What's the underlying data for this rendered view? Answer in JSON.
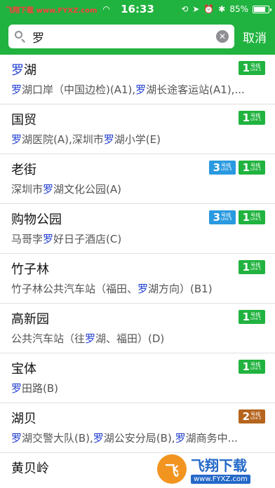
{
  "status_bar": {
    "watermark": "飞翔下载 www.FYXZ.com",
    "time": "16:33",
    "battery": "85%",
    "battery_level": 0.85,
    "icons": [
      "wifi-icon",
      "orientation-lock-icon",
      "location-icon",
      "alarm-icon",
      "bluetooth-icon",
      "battery-icon"
    ]
  },
  "search": {
    "value": "罗",
    "placeholder": "",
    "cancel_label": "取消"
  },
  "colors": {
    "brand_green": "#21b33f",
    "highlight_blue": "#1e3cd0",
    "line1": "#21b33f",
    "line2": "#b5651d",
    "line3": "#2a9ae0"
  },
  "results": [
    {
      "name_parts": [
        {
          "t": "罗",
          "hl": true
        },
        {
          "t": "湖",
          "hl": false
        }
      ],
      "lines": [
        {
          "num": "1",
          "zh": "号线",
          "en": "Line 1",
          "color": "#21b33f"
        }
      ],
      "exit_parts": [
        {
          "t": "罗",
          "hl": true
        },
        {
          "t": "湖口岸（中国边检)(A1),",
          "hl": false
        },
        {
          "t": "罗",
          "hl": true
        },
        {
          "t": "湖长途客运站(A1),...",
          "hl": false
        }
      ]
    },
    {
      "name_parts": [
        {
          "t": "国贸",
          "hl": false
        }
      ],
      "lines": [
        {
          "num": "1",
          "zh": "号线",
          "en": "Line 1",
          "color": "#21b33f"
        }
      ],
      "exit_parts": [
        {
          "t": "罗",
          "hl": true
        },
        {
          "t": "湖医院(A),深圳市",
          "hl": false
        },
        {
          "t": "罗",
          "hl": true
        },
        {
          "t": "湖小学(E)",
          "hl": false
        }
      ]
    },
    {
      "name_parts": [
        {
          "t": "老街",
          "hl": false
        }
      ],
      "lines": [
        {
          "num": "3",
          "zh": "号线",
          "en": "Line 3",
          "color": "#2a9ae0"
        },
        {
          "num": "1",
          "zh": "号线",
          "en": "Line 1",
          "color": "#21b33f"
        }
      ],
      "exit_parts": [
        {
          "t": "深圳市",
          "hl": false
        },
        {
          "t": "罗",
          "hl": true
        },
        {
          "t": "湖文化公园(A)",
          "hl": false
        }
      ]
    },
    {
      "name_parts": [
        {
          "t": "购物公园",
          "hl": false
        }
      ],
      "lines": [
        {
          "num": "3",
          "zh": "号线",
          "en": "Line 3",
          "color": "#2a9ae0"
        },
        {
          "num": "1",
          "zh": "号线",
          "en": "Line 1",
          "color": "#21b33f"
        }
      ],
      "exit_parts": [
        {
          "t": "马哥孛",
          "hl": false
        },
        {
          "t": "罗",
          "hl": true
        },
        {
          "t": "好日子酒店(C)",
          "hl": false
        }
      ]
    },
    {
      "name_parts": [
        {
          "t": "竹子林",
          "hl": false
        }
      ],
      "lines": [
        {
          "num": "1",
          "zh": "号线",
          "en": "Line 1",
          "color": "#21b33f"
        }
      ],
      "exit_parts": [
        {
          "t": "竹子林公共汽车站（福田、",
          "hl": false
        },
        {
          "t": "罗",
          "hl": true
        },
        {
          "t": "湖方向）(B1)",
          "hl": false
        }
      ]
    },
    {
      "name_parts": [
        {
          "t": "高新园",
          "hl": false
        }
      ],
      "lines": [
        {
          "num": "1",
          "zh": "号线",
          "en": "Line 1",
          "color": "#21b33f"
        }
      ],
      "exit_parts": [
        {
          "t": "公共汽车站（往",
          "hl": false
        },
        {
          "t": "罗",
          "hl": true
        },
        {
          "t": "湖、福田）(D)",
          "hl": false
        }
      ]
    },
    {
      "name_parts": [
        {
          "t": "宝体",
          "hl": false
        }
      ],
      "lines": [
        {
          "num": "1",
          "zh": "号线",
          "en": "Line 1",
          "color": "#21b33f"
        }
      ],
      "exit_parts": [
        {
          "t": "罗",
          "hl": true
        },
        {
          "t": "田路(B)",
          "hl": false
        }
      ]
    },
    {
      "name_parts": [
        {
          "t": "湖贝",
          "hl": false
        }
      ],
      "lines": [
        {
          "num": "2",
          "zh": "号线",
          "en": "Line 2",
          "color": "#b5651d"
        }
      ],
      "exit_parts": [
        {
          "t": "罗",
          "hl": true
        },
        {
          "t": "湖交警大队(B),",
          "hl": false
        },
        {
          "t": "罗",
          "hl": true
        },
        {
          "t": "湖公安分局(B),",
          "hl": false
        },
        {
          "t": "罗",
          "hl": true
        },
        {
          "t": "湖商务中...",
          "hl": false
        }
      ]
    },
    {
      "name_parts": [
        {
          "t": "黄贝岭",
          "hl": false
        }
      ],
      "lines": [],
      "exit_parts": []
    }
  ],
  "watermark_bottom": {
    "logo_text": "飞",
    "title": "飞翔下载",
    "url": "www.FYXZ.com"
  }
}
